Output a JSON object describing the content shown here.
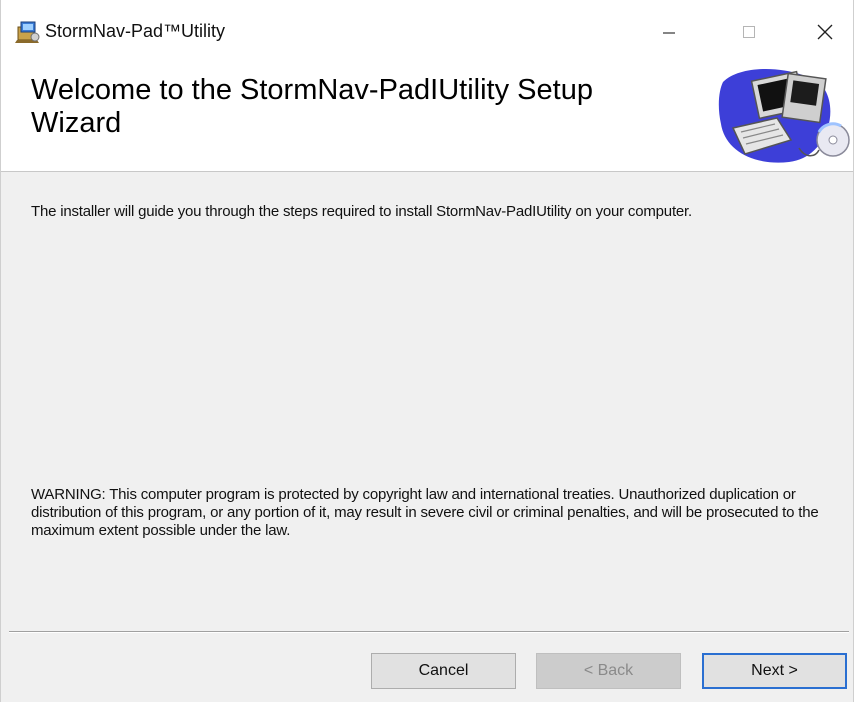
{
  "window": {
    "title": "StormNav-Pad™Utility",
    "icon": "installer-package-icon",
    "controls": {
      "minimize_icon": "minimize-icon",
      "maximize_icon": "maximize-icon",
      "close_icon": "close-icon"
    }
  },
  "header": {
    "title": "Welcome to the StormNav-PadIUtility Setup Wizard",
    "art_icon": "computer-setup-icon"
  },
  "content": {
    "intro": "The installer will guide you through the steps required to install StormNav-PadIUtility on your computer.",
    "warning": "WARNING: This computer program is protected by copyright law and international treaties. Unauthorized duplication or distribution of this program, or any portion of it, may result in severe civil or criminal penalties, and will be prosecuted to the maximum extent possible under the law."
  },
  "buttons": {
    "cancel": "Cancel",
    "back": "< Back",
    "next": "Next >"
  },
  "colors": {
    "focus_border": "#2a6fd1",
    "button_face": "#e1e1e1",
    "dialog_background": "#f0f0f0"
  }
}
